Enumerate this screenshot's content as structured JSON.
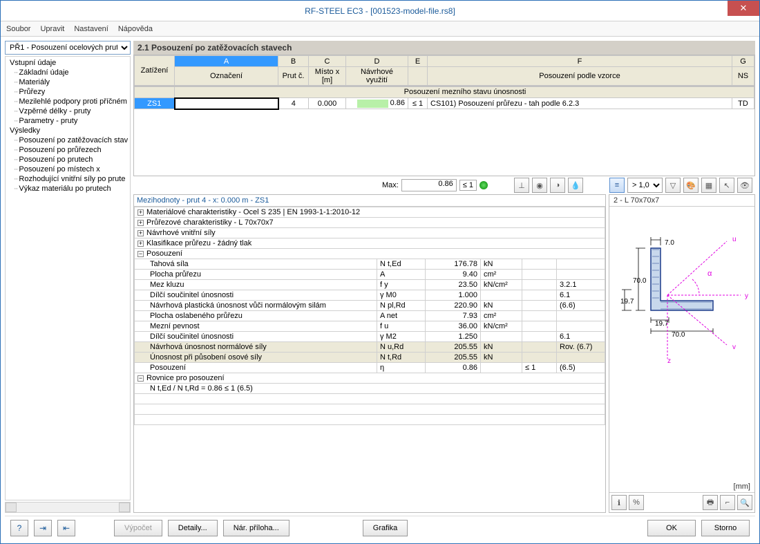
{
  "window": {
    "title": "RF-STEEL EC3 - [001523-model-file.rs8]"
  },
  "menu": [
    "Soubor",
    "Upravit",
    "Nastavení",
    "Nápověda"
  ],
  "nav": {
    "selector": "PŘ1 - Posouzení ocelových prut",
    "group1": "Vstupní údaje",
    "g1_items": [
      "Základní údaje",
      "Materiály",
      "Průřezy",
      "Mezilehlé podpory proti příčném",
      "Vzpěrné délky - pruty",
      "Parametry - pruty"
    ],
    "group2": "Výsledky",
    "g2_items": [
      "Posouzení po zatěžovacích stav",
      "Posouzení po průřezech",
      "Posouzení po prutech",
      "Posouzení po místech x",
      "Rozhodující vnitřní síly po prute",
      "Výkaz materiálu po prutech"
    ]
  },
  "section_title": "2.1 Posouzení po zatěžovacích stavech",
  "grid": {
    "col_letters": [
      "A",
      "B",
      "C",
      "D",
      "E",
      "F",
      "G"
    ],
    "row_hdr": "Zatížení",
    "h_A": "Označení",
    "h_B": "Prut č.",
    "h_C": "Místo x [m]",
    "h_D": "Návrhové využití",
    "h_E": "",
    "h_F": "Posouzení podle vzorce",
    "h_G": "NS",
    "group_row": "Posouzení mezního stavu únosnosti",
    "row1": {
      "lc": "ZS1",
      "name": "",
      "member": "4",
      "x": "0.000",
      "util": "0.86",
      "leq": "≤ 1",
      "formula": "CS101) Posouzení průřezu - tah podle 6.2.3",
      "ns": "TD"
    }
  },
  "maxbar": {
    "label": "Max:",
    "value": "0.86",
    "leq": "≤ 1",
    "scale": "> 1,0"
  },
  "details": {
    "header": "Mezihodnoty - prut 4 - x: 0.000 m - ZS1",
    "exp": [
      "Materiálové charakteristiky - Ocel S 235 | EN 1993-1-1:2010-12",
      "Průřezové charakteristiky  -  L 70x70x7",
      "Návrhové vnitřní síly",
      "Klasifikace průřezu - žádný tlak"
    ],
    "posouzeni_label": "Posouzení",
    "rows": [
      {
        "n": "Tahová síla",
        "s": "N t,Ed",
        "v": "176.78",
        "u": "kN",
        "r": ""
      },
      {
        "n": "Plocha průřezu",
        "s": "A",
        "v": "9.40",
        "u": "cm²",
        "r": ""
      },
      {
        "n": "Mez kluzu",
        "s": "f y",
        "v": "23.50",
        "u": "kN/cm²",
        "r": "3.2.1"
      },
      {
        "n": "Dílčí součinitel únosnosti",
        "s": "γ M0",
        "v": "1.000",
        "u": "",
        "r": "6.1"
      },
      {
        "n": "Návrhová plastická únosnost vůči normálovým silám",
        "s": "N pl,Rd",
        "v": "220.90",
        "u": "kN",
        "r": "(6.6)"
      },
      {
        "n": "Plocha oslabeného průřezu",
        "s": "A net",
        "v": "7.93",
        "u": "cm²",
        "r": ""
      },
      {
        "n": "Mezní pevnost",
        "s": "f u",
        "v": "36.00",
        "u": "kN/cm²",
        "r": ""
      },
      {
        "n": "Dílčí součinitel únosnosti",
        "s": "γ M2",
        "v": "1.250",
        "u": "",
        "r": "6.1"
      },
      {
        "n": "Návrhová únosnost normálové síly",
        "s": "N u,Rd",
        "v": "205.55",
        "u": "kN",
        "r": "Rov. (6.7)",
        "sh": true
      },
      {
        "n": "Únosnost při působení osové síly",
        "s": "N t,Rd",
        "v": "205.55",
        "u": "kN",
        "r": "",
        "sh": true
      },
      {
        "n": "Posouzení",
        "s": "η",
        "v": "0.86",
        "u": "",
        "leq": "≤ 1",
        "r": "(6.5)"
      }
    ],
    "eq_label": "Rovnice pro posouzení",
    "eq": "N t,Ed / N t,Rd = 0.86 ≤ 1   (6.5)"
  },
  "preview": {
    "title": "2 - L 70x70x7",
    "d1": "70.0",
    "d2": "7.0",
    "d3": "19.7",
    "d4": "19.7",
    "d5": "70.0",
    "unit": "[mm]",
    "ax_u": "u",
    "ax_y": "y",
    "ax_v": "v",
    "ax_z": "z",
    "ax_a": "α"
  },
  "buttons": {
    "calc": "Výpočet",
    "details": "Detaily...",
    "annex": "Nár. příloha...",
    "graphics": "Grafika",
    "ok": "OK",
    "cancel": "Storno"
  }
}
